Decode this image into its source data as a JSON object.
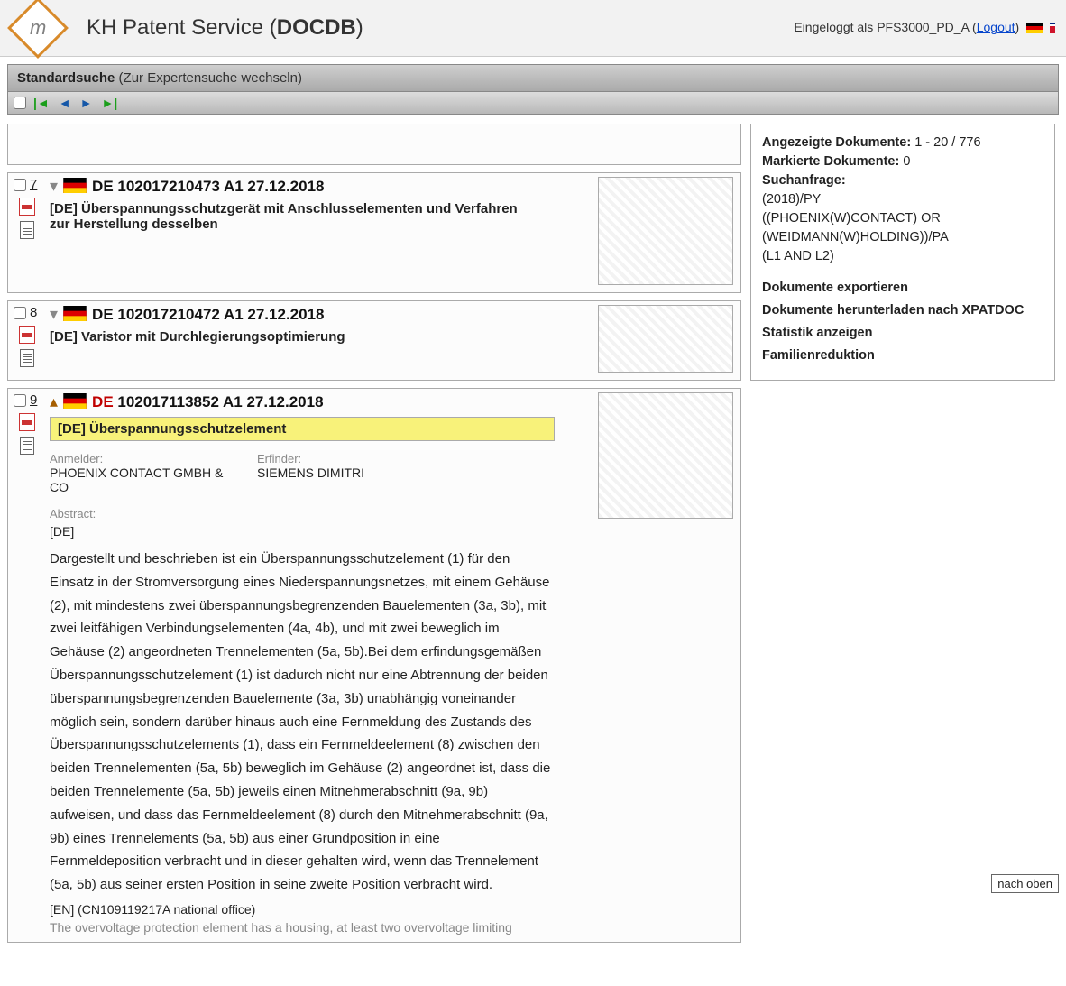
{
  "header": {
    "logo_letter": "m",
    "title_prefix": "KH Patent Service (",
    "title_bold": "DOCDB",
    "title_suffix": ")",
    "login_text_prefix": "Eingeloggt als ",
    "login_user": "PFS3000_PD_A",
    "login_paren_open": " (",
    "logout": "Logout",
    "login_paren_close": ")"
  },
  "modebar": {
    "bold": "Standardsuche",
    "rest": " (Zur Expertensuche wechseln)"
  },
  "docs": [
    {
      "num": "7",
      "expanded": false,
      "cc": "DE",
      "id_rest": " 102017210473 A1 27.12.2018",
      "title": "[DE] Überspannungsschutzgerät mit Anschlusselementen und Verfahren zur Herstellung desselben"
    },
    {
      "num": "8",
      "expanded": false,
      "cc": "DE",
      "id_rest": " 102017210472 A1 27.12.2018",
      "title": "[DE] Varistor mit Durchlegierungsoptimierung"
    },
    {
      "num": "9",
      "expanded": true,
      "cc": "DE",
      "id_rest": " 102017113852 A1 27.12.2018",
      "title": "[DE] Überspannungsschutzelement",
      "anmelder_lbl": "Anmelder:",
      "anmelder": "PHOENIX CONTACT GMBH & CO",
      "erfinder_lbl": "Erfinder:",
      "erfinder": "SIEMENS DIMITRI",
      "abs_lbl": "Abstract:",
      "abs_lang": "[DE]",
      "abs_body": "Dargestellt und beschrieben ist ein Überspannungsschutzelement (1) für den Einsatz in der Stromversorgung eines Niederspannungsnetzes, mit einem Gehäuse (2), mit mindestens zwei überspannungsbegrenzenden Bauelementen (3a, 3b), mit zwei leitfähigen Verbindungselementen (4a, 4b), und mit zwei beweglich im Gehäuse (2) angeordneten Trennelementen (5a, 5b).Bei dem erfindungsgemäßen Überspannungsschutzelement (1) ist dadurch nicht nur eine Abtrennung der beiden überspannungsbegrenzenden Bauelemente (3a, 3b) unabhängig voneinander möglich sein, sondern darüber hinaus auch eine Fernmeldung des Zustands des Überspannungsschutzelements (1), dass ein Fernmeldeelement (8) zwischen den beiden Trennelementen (5a, 5b) beweglich im Gehäuse (2) angeordnet ist, dass die beiden Trennelemente (5a, 5b) jeweils einen Mitnehmerabschnitt (9a, 9b) aufweisen, und dass das Fernmeldeelement (8) durch den Mitnehmerabschnitt (9a, 9b) eines Trennelements (5a, 5b) aus einer Grundposition in eine Fernmeldeposition verbracht und in dieser gehalten wird, wenn das Trennelement (5a, 5b) aus seiner ersten Position in seine zweite Position verbracht wird.",
      "abs_en": "[EN] (CN109119217A national office)",
      "abs_en_body": "The overvoltage protection element has a housing, at least two overvoltage limiting"
    }
  ],
  "side": {
    "shown_lbl": "Angezeigte Dokumente:",
    "shown_val": " 1 - 20 / 776",
    "marked_lbl": "Markierte Dokumente:",
    "marked_val": " 0",
    "query_lbl": "Suchanfrage:",
    "q1": "(2018)/PY",
    "q2": "((PHOENIX(W)CONTACT) OR (WEIDMANN(W)HOLDING))/PA",
    "q3": "(L1 AND L2)",
    "link_export": "Dokumente exportieren",
    "link_download": "Dokumente herunterladen nach XPATDOC",
    "link_stats": "Statistik anzeigen",
    "link_family": "Familienreduktion"
  },
  "back_to_top": "nach oben"
}
